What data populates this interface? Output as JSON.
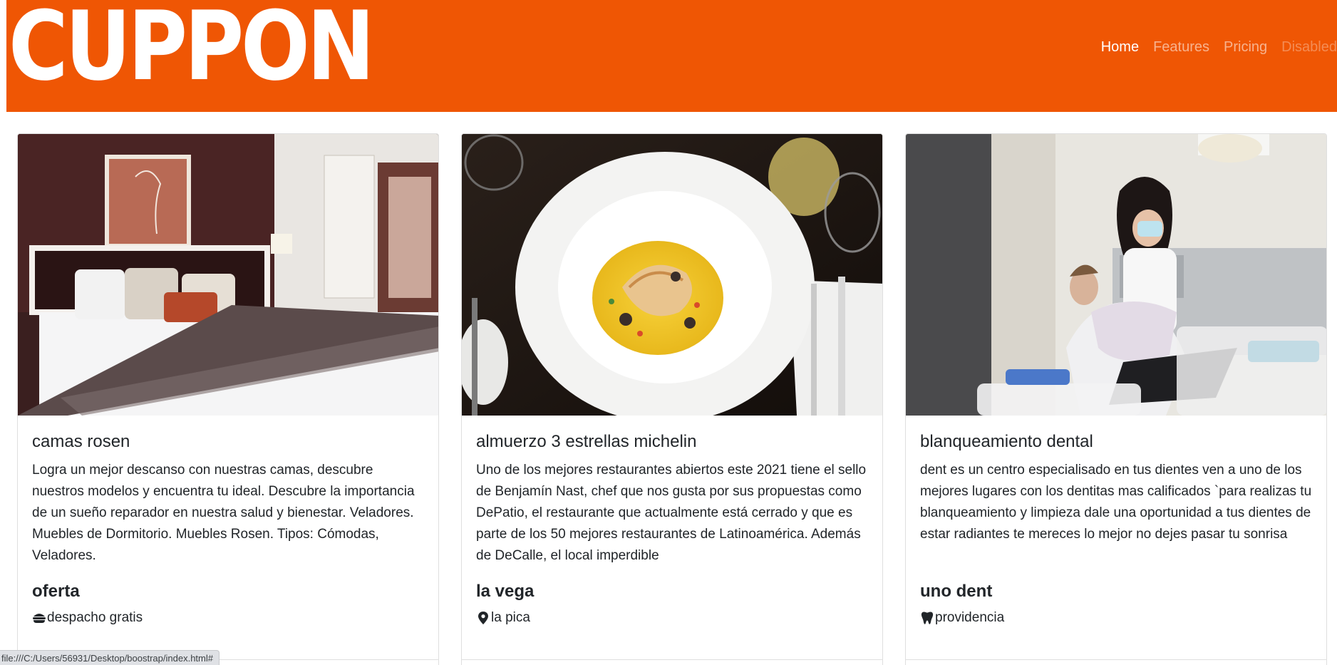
{
  "brand": "CUPPON",
  "colors": {
    "navbar": "#ef5604",
    "link_active": "#ffffff"
  },
  "nav": {
    "items": [
      {
        "label": "Home",
        "state": "active"
      },
      {
        "label": "Features",
        "state": "normal"
      },
      {
        "label": "Pricing",
        "state": "normal"
      },
      {
        "label": "Disabled",
        "state": "disabled"
      }
    ]
  },
  "cards": [
    {
      "image": "hotel-bedroom-photo",
      "title": "camas rosen",
      "text": "Logra un mejor descanso con nuestras camas, descubre nuestros modelos y encuentra tu ideal. Descubre la importancia de un sueño reparador en nuestra salud y bienestar. Veladores. Muebles de Dormitorio. Muebles Rosen. Tipos: Cómodas, Veladores.",
      "subtitle": "oferta",
      "meta_icon": "hamburger-icon",
      "meta": "despacho gratis"
    },
    {
      "image": "fish-dish-photo",
      "title": "almuerzo 3 estrellas michelin",
      "text": "Uno de los mejores restaurantes abiertos este 2021 tiene el sello de Benjamín Nast, chef que nos gusta por sus propuestas como DePatio, el restaurante que actualmente está cerrado y que es parte de los 50 mejores restaurantes de Latinoamérica. Además de DeCalle, el local imperdible",
      "subtitle": "la vega",
      "meta_icon": "map-pin-icon",
      "meta": "la pica"
    },
    {
      "image": "dental-clinic-photo",
      "title": "blanqueamiento dental",
      "text": "dent es un centro especialisado en tus dientes ven a uno de los mejores lugares con los dentitas mas calificados `para realizas tu blanqueamiento y limpieza dale una oportunidad a tus dientes de estar radiantes te mereces lo mejor no dejes pasar tu sonrisa",
      "subtitle": "uno dent",
      "meta_icon": "tooth-icon",
      "meta": "providencia"
    }
  ],
  "status_bar": "file:///C:/Users/56931/Desktop/boostrap/index.html#"
}
